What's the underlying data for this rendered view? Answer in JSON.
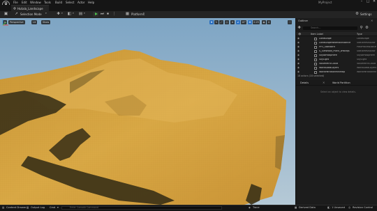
{
  "menu": {
    "logo": "U",
    "items": [
      "File",
      "Edit",
      "Window",
      "Tools",
      "Build",
      "Select",
      "Actor",
      "Help"
    ],
    "project_title": "MyProject",
    "window_buttons": [
      "–",
      "□",
      "✕"
    ]
  },
  "level_tab": {
    "label": "Hutala_Landscape"
  },
  "toolbar": {
    "mode_label": "Selection Mode",
    "platforms_label": "Platforms",
    "settings_label": "Settings"
  },
  "viewport": {
    "perspective_label": "Perspective",
    "lit_label": "Lit",
    "show_label": "Show",
    "snap_angle": "10°",
    "snap_scale": "0.25",
    "camera_speed": "4",
    "colors": {
      "sky": "#8fb2cc",
      "sand": "#d3a241",
      "shadow": "#3e3419"
    }
  },
  "outliner": {
    "tab_label": "Outliner",
    "search_placeholder": "Search...",
    "col_item_label": "Item Label",
    "col_type": "Type",
    "rows": [
      {
        "name": "Landscape",
        "type": "Landscape"
      },
      {
        "name": "LandscapeMaterialInstance",
        "type": "StaticMeshActor"
      },
      {
        "name": "PP3_Standard",
        "type": "PostProcessVolume"
      },
      {
        "name": "S_Siefwood_Plank_wfbvdjs",
        "type": "StaticMeshActor"
      },
      {
        "name": "SkyAtmosphere",
        "type": "SkyAtmosphere"
      },
      {
        "name": "SkyLight",
        "type": "SkyLight"
      },
      {
        "name": "VolumetricCloud",
        "type": "VolumetricCloud"
      },
      {
        "name": "WorldDataLayers",
        "type": "WorldDataLayers"
      },
      {
        "name": "WorldPartitionMiniMap",
        "type": "WorldPartitionMiniMap"
      }
    ],
    "status": "18 actors (18 selected)"
  },
  "details": {
    "tab_label": "Details",
    "world_partition_label": "World Partition",
    "empty_message": "Select an object to view details."
  },
  "statusbar": {
    "content_drawer": "Content Drawer",
    "output_log": "Output Log",
    "cmd_label": "Cmd",
    "cmd_placeholder": "Enter Console Command",
    "trace": "Trace",
    "derived_data": "Derived Data",
    "unsaved": "1 Unsaved",
    "revision_control": "Revision Control"
  }
}
